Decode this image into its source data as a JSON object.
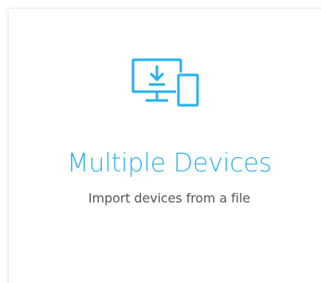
{
  "card": {
    "icon": "import-devices-icon",
    "title": "Multiple Devices",
    "subtitle": "Import devices from a file"
  },
  "colors": {
    "accent": "#2ab2ef",
    "subtitle": "#555555",
    "background": "#ffffff"
  }
}
